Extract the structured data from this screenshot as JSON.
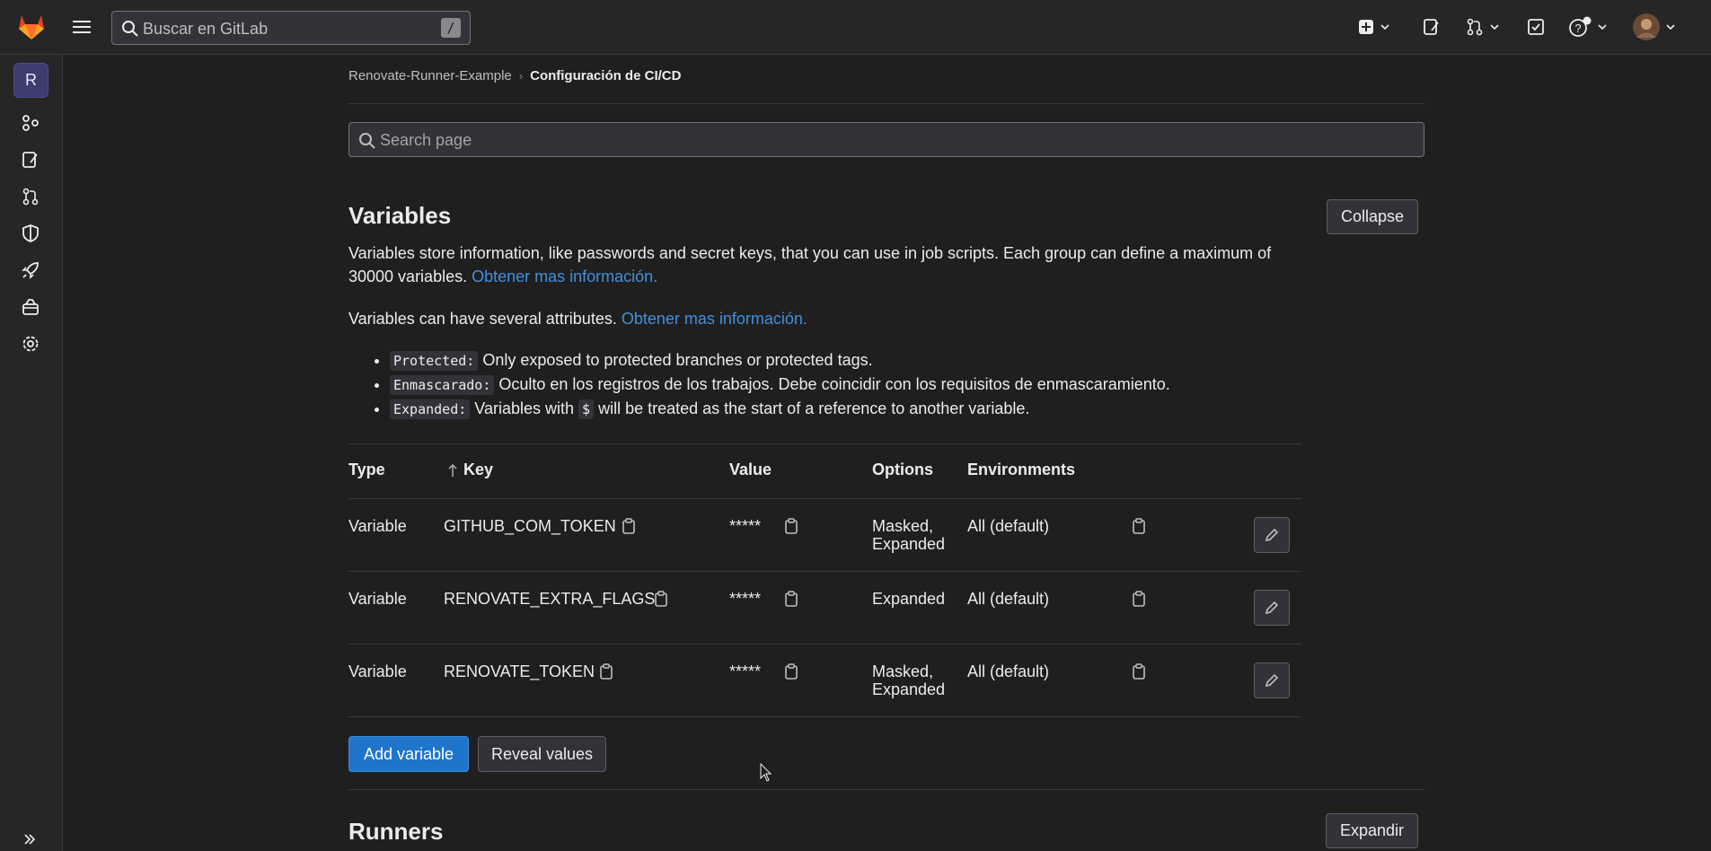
{
  "topbar": {
    "search_placeholder": "Buscar en GitLab",
    "search_shortcut": "/"
  },
  "sidebar": {
    "project_initial": "R",
    "items": [
      {
        "icon": "project-overview-icon"
      },
      {
        "icon": "issues-icon"
      },
      {
        "icon": "merge-requests-icon"
      },
      {
        "icon": "security-icon"
      },
      {
        "icon": "deployments-icon"
      },
      {
        "icon": "packages-icon"
      },
      {
        "icon": "settings-icon"
      }
    ]
  },
  "breadcrumb": {
    "parent": "Renovate-Runner-Example",
    "current": "Configuración de CI/CD"
  },
  "page_search": {
    "placeholder": "Search page"
  },
  "variables": {
    "title": "Variables",
    "collapse_label": "Collapse",
    "description": "Variables store information, like passwords and secret keys, that you can use in job scripts. Each group can define a maximum of 30000 variables.",
    "learn_more": "Obtener mas información.",
    "attributes_intro": "Variables can have several attributes.",
    "attributes": [
      {
        "code": "Protected:",
        "text": "Only exposed to protected branches or protected tags."
      },
      {
        "code": "Enmascarado:",
        "text": "Oculto en los registros de los trabajos. Debe coincidir con los requisitos de enmascaramiento."
      },
      {
        "code": "Expanded:",
        "text_before": "Variables with",
        "inline_code": "$",
        "text_after": "will be treated as the start of a reference to another variable."
      }
    ],
    "table": {
      "headers": {
        "type": "Type",
        "key": "Key",
        "value": "Value",
        "options": "Options",
        "environments": "Environments"
      },
      "rows": [
        {
          "type": "Variable",
          "key": "GITHUB_COM_TOKEN",
          "value": "*****",
          "options_line1": "Masked,",
          "options_line2": "Expanded",
          "environment": "All (default)"
        },
        {
          "type": "Variable",
          "key": "RENOVATE_EXTRA_FLAGS",
          "value": "*****",
          "options_line1": "Expanded",
          "options_line2": "",
          "environment": "All (default)"
        },
        {
          "type": "Variable",
          "key": "RENOVATE_TOKEN",
          "value": "*****",
          "options_line1": "Masked,",
          "options_line2": "Expanded",
          "environment": "All (default)"
        }
      ]
    },
    "add_label": "Add variable",
    "reveal_label": "Reveal values"
  },
  "runners": {
    "title": "Runners",
    "expand_label": "Expandir"
  },
  "colors": {
    "background": "#1f1f1f",
    "link": "#428fdc",
    "primary_button": "#1f75cb",
    "gitlab_orange": "#fc6d26"
  }
}
